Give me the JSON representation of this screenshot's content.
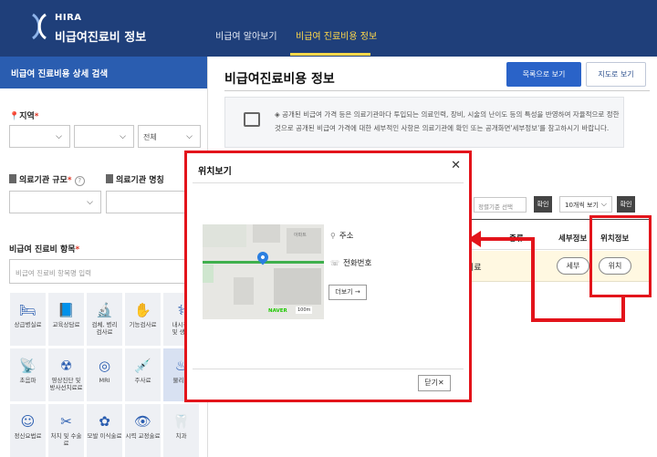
{
  "header": {
    "logo_abbr": "HIRA",
    "logo_title": "비급여진료비 정보",
    "nav": [
      "비급여 알아보기",
      "비급여 진료비용 정보"
    ]
  },
  "sidebar": {
    "title": "비급여 진료비용 상세 검색",
    "region_label": "지역",
    "region_selects": [
      "",
      "",
      "전체"
    ],
    "inst_scale_label": "의료기관 규모",
    "inst_name_label": "의료기관 명칭",
    "item_label": "비급여 진료비 항목",
    "item_placeholder": "비급여 진료비 항목명 입력",
    "tiles": [
      {
        "icon": "bed-icon",
        "glyph": "🛏",
        "label": "상급병실료"
      },
      {
        "icon": "book-icon",
        "glyph": "📘",
        "label": "교육상담료"
      },
      {
        "icon": "microscope-icon",
        "glyph": "🔬",
        "label": "검체, 병리\n검사료"
      },
      {
        "icon": "hand-icon",
        "glyph": "✋",
        "label": "기능검사료"
      },
      {
        "icon": "endoscope-icon",
        "glyph": "⚕",
        "label": "내시경,\n및 생검"
      },
      {
        "icon": "ultrasound-icon",
        "glyph": "📡",
        "label": "초음파"
      },
      {
        "icon": "xray-icon",
        "glyph": "☢",
        "label": "영상진단 및\n방사선치료료"
      },
      {
        "icon": "mri-icon",
        "glyph": "◎",
        "label": "MRI"
      },
      {
        "icon": "syringe-icon",
        "glyph": "💉",
        "label": "주사료"
      },
      {
        "icon": "physio-icon",
        "glyph": "♨",
        "label": "물리치"
      },
      {
        "icon": "psych-icon",
        "glyph": "☺",
        "label": "정신요법료"
      },
      {
        "icon": "scalpel-icon",
        "glyph": "✂",
        "label": "처치 및 수술료"
      },
      {
        "icon": "hair-icon",
        "glyph": "✿",
        "label": "모발 이식술료"
      },
      {
        "icon": "eye-icon",
        "glyph": "👁",
        "label": "시력 교정술료"
      },
      {
        "icon": "tooth-icon",
        "glyph": "🦷",
        "label": "치과"
      }
    ]
  },
  "main": {
    "title": "비급여진료비용 정보",
    "btn_list": "목록으로 보기",
    "btn_map": "지도로 보기",
    "notice": "◈ 공개된 비급여 가격 등은 의료기관마다 투입되는 의료인력, 장비, 시술의 난이도 등의 특성을 반영하여 자율적으로 정한 것으로 공개된 비급여 가격에 대한 세부적인 사항은 의료기관에 확인 또는 공개화면'세부정보'를 참고하시기 바랍니다.",
    "filter_placeholder": "정렬기준 선택",
    "confirm": "확인",
    "per_page": "10개씩 보기",
    "th_type": "종류",
    "th_detail": "세부정보",
    "th_location": "위치정보",
    "row_text": "치료",
    "btn_detail": "세부",
    "btn_location": "위치"
  },
  "popup": {
    "title": "위치보기",
    "address_label": "주소",
    "phone_label": "전화번호",
    "more": "더보기 →",
    "close": "닫기✕",
    "map_brand": "NAVER",
    "map_scale": "100m",
    "map_place": "아파트"
  },
  "colors": {
    "header": "#1f3f7a",
    "accent": "#2a63c8",
    "annotation": "#e3141b",
    "highlight_row": "#fff8e1"
  }
}
